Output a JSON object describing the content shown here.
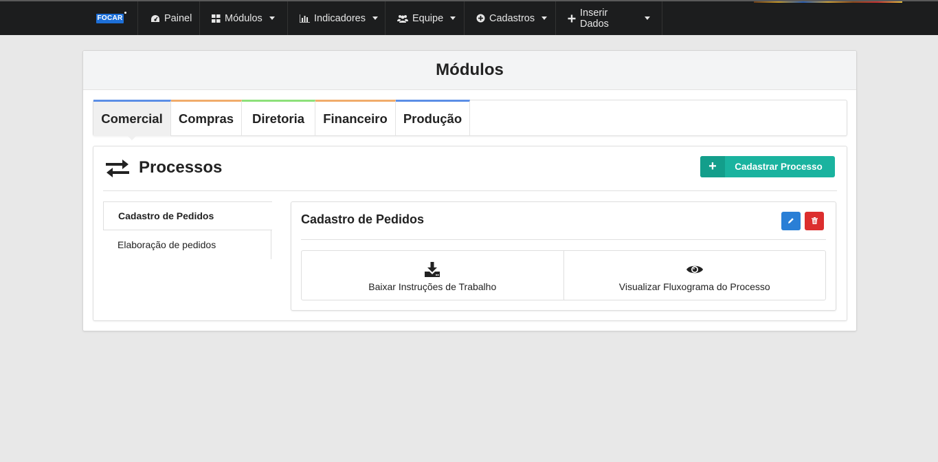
{
  "navbar": {
    "brand": "FOCAR",
    "items": [
      {
        "label": "Painel",
        "icon": "dashboard-icon",
        "has_caret": false
      },
      {
        "label": "Módulos",
        "icon": "grid-icon",
        "has_caret": true
      },
      {
        "label": "Indicadores",
        "icon": "bar-chart-icon",
        "has_caret": true
      },
      {
        "label": "Equipe",
        "icon": "users-icon",
        "has_caret": true
      },
      {
        "label": "Cadastros",
        "icon": "plus-circle-icon",
        "has_caret": true
      },
      {
        "label": "Inserir Dados",
        "icon": "plus-icon",
        "has_caret": true
      }
    ]
  },
  "page": {
    "title": "Módulos"
  },
  "tabs": [
    {
      "label": "Comercial",
      "color": "#5b8ee6",
      "active": true
    },
    {
      "label": "Compras",
      "color": "#f0ac6b",
      "active": false
    },
    {
      "label": "Diretoria",
      "color": "#8de07a",
      "active": false
    },
    {
      "label": "Financeiro",
      "color": "#f0ac6b",
      "active": false
    },
    {
      "label": "Produção",
      "color": "#5b8ee6",
      "active": false
    }
  ],
  "processos": {
    "title": "Processos",
    "icon": "exchange-arrows-icon",
    "add_button": "Cadastrar Processo",
    "list": [
      {
        "label": "Cadastro de Pedidos",
        "active": true
      },
      {
        "label": "Elaboração de pedidos",
        "active": false
      }
    ],
    "detail": {
      "title": "Cadastro de Pedidos",
      "edit_icon": "pencil-icon",
      "delete_icon": "trash-icon",
      "actions": [
        {
          "label": "Baixar Instruções de Trabalho",
          "icon": "download-icon"
        },
        {
          "label": "Visualizar Fluxograma do Processo",
          "icon": "eye-icon"
        }
      ]
    }
  },
  "colors": {
    "navbar_bg": "#1c1d1e",
    "accent_teal": "#1ab39f",
    "edit_blue": "#2a7fd6",
    "delete_red": "#dc2e2e"
  }
}
